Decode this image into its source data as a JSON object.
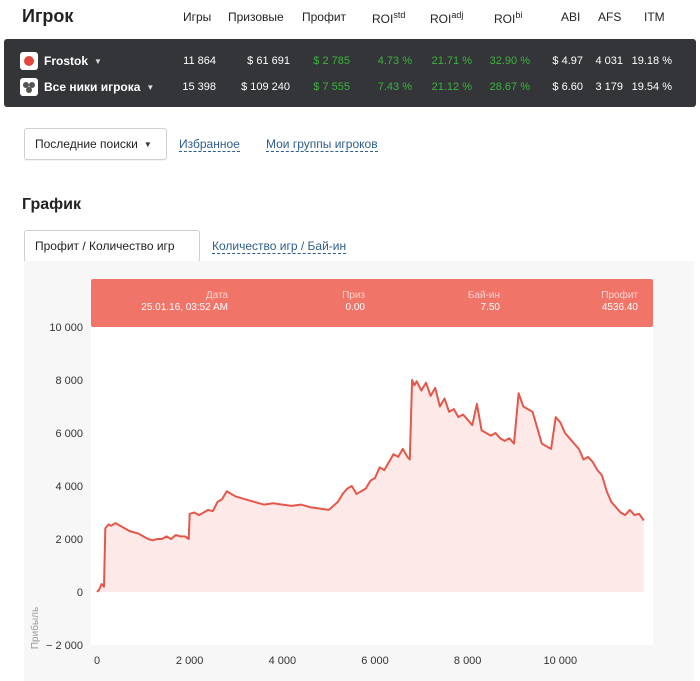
{
  "header": {
    "title": "Игрок",
    "columns": [
      {
        "label": "Игры",
        "sup": ""
      },
      {
        "label": "Призовые",
        "sup": ""
      },
      {
        "label": "Профит",
        "sup": ""
      },
      {
        "label": "ROI",
        "sup": "std"
      },
      {
        "label": "ROI",
        "sup": "adj"
      },
      {
        "label": "ROI",
        "sup": "bi"
      },
      {
        "label": "ABI",
        "sup": ""
      },
      {
        "label": "AFS",
        "sup": ""
      },
      {
        "label": "ITM",
        "sup": ""
      }
    ]
  },
  "players": [
    {
      "name": "Frostok",
      "icon": "pokerstars-icon",
      "games": "11 864",
      "prize": "$ 61 691",
      "profit": "$ 2 785",
      "roi_std": "4.73 %",
      "roi_adj": "21.71 %",
      "roi_bi": "32.90 %",
      "abi": "$ 4.97",
      "afs": "4 031",
      "itm": "19.18 %"
    },
    {
      "name": "Все ники игрока",
      "icon": "group-icon",
      "games": "15 398",
      "prize": "$ 109 240",
      "profit": "$ 7 555",
      "roi_std": "7.43 %",
      "roi_adj": "21.12 %",
      "roi_bi": "28.67 %",
      "abi": "$ 6.60",
      "afs": "3 179",
      "itm": "19.54 %"
    }
  ],
  "search": {
    "recent_label": "Последние поиски",
    "favorites_label": "Избранное",
    "groups_label": "Мои группы игроков"
  },
  "graph": {
    "title": "График",
    "tab_active": "Профит / Количество игр",
    "tab_other": "Количество игр / Бай-ин"
  },
  "tooltip": {
    "date_label": "Дата",
    "date_value": "25.01.16, 03:52 AM",
    "prize_label": "Приз",
    "prize_value": "0.00",
    "buyin_label": "Бай-ин",
    "buyin_value": "7.50",
    "profit_label": "Профит",
    "profit_value": "4536.40"
  },
  "colors": {
    "line": "#e5574a",
    "fill": "#fde9e7",
    "tooltip_bg": "#f17469",
    "positive": "#3fb23f",
    "table_bg": "#333538"
  },
  "chart_data": {
    "type": "area",
    "ylabel": "Прибыль",
    "xlabel": "",
    "xlim": [
      0,
      12000
    ],
    "ylim": [
      -2000,
      10000
    ],
    "x_ticks": [
      0,
      2000,
      4000,
      6000,
      8000,
      10000
    ],
    "x_tick_labels": [
      "0",
      "2 000",
      "4 000",
      "6 000",
      "8 000",
      "10 000"
    ],
    "y_ticks": [
      -2000,
      0,
      2000,
      4000,
      6000,
      8000,
      10000
    ],
    "y_tick_labels": [
      "− 2 000",
      "0",
      "2 000",
      "4 000",
      "6 000",
      "8 000",
      "10 000"
    ],
    "series": [
      {
        "x": [
          0,
          50,
          100,
          150,
          180,
          250,
          300,
          400,
          500,
          700,
          900,
          1100,
          1200,
          1300,
          1400,
          1500,
          1600,
          1700,
          1800,
          1900,
          1980,
          2000,
          2100,
          2200,
          2300,
          2400,
          2500,
          2600,
          2700,
          2800,
          2900,
          3000,
          3200,
          3400,
          3600,
          3800,
          4000,
          4200,
          4400,
          4600,
          4800,
          5000,
          5200,
          5300,
          5400,
          5500,
          5600,
          5700,
          5800,
          5900,
          6000,
          6100,
          6200,
          6300,
          6400,
          6500,
          6600,
          6700,
          6750,
          6800,
          6850,
          6900,
          7000,
          7100,
          7200,
          7300,
          7400,
          7500,
          7600,
          7700,
          7800,
          7900,
          8000,
          8100,
          8200,
          8300,
          8400,
          8500,
          8600,
          8700,
          8800,
          8900,
          9000,
          9100,
          9200,
          9300,
          9400,
          9500,
          9600,
          9700,
          9800,
          9900,
          10000,
          10100,
          10200,
          10300,
          10400,
          10500,
          10600,
          10700,
          10800,
          10900,
          11000,
          11100,
          11200,
          11300,
          11400,
          11500,
          11600,
          11700,
          11800
        ],
        "y": [
          0,
          100,
          300,
          200,
          2400,
          2550,
          2500,
          2600,
          2500,
          2300,
          2200,
          2000,
          1950,
          2000,
          2000,
          2100,
          2000,
          2150,
          2100,
          2100,
          2000,
          2950,
          3000,
          2900,
          3000,
          3100,
          3050,
          3400,
          3500,
          3800,
          3700,
          3600,
          3500,
          3400,
          3300,
          3350,
          3300,
          3250,
          3300,
          3200,
          3150,
          3100,
          3400,
          3700,
          3900,
          4000,
          3700,
          3800,
          3900,
          4200,
          4300,
          4700,
          4600,
          4900,
          5200,
          5100,
          5400,
          5100,
          5000,
          8000,
          7800,
          7950,
          7600,
          7900,
          7400,
          7700,
          7000,
          7300,
          6800,
          6900,
          6600,
          6700,
          6500,
          6300,
          7100,
          6100,
          6000,
          5900,
          6000,
          5800,
          5700,
          5800,
          5600,
          7500,
          7000,
          6900,
          6800,
          6200,
          5600,
          5500,
          5400,
          6600,
          6400,
          6000,
          5800,
          5600,
          5400,
          5000,
          5100,
          4900,
          4600,
          4400,
          3800,
          3400,
          3200,
          3000,
          2900,
          3100,
          2900,
          2950,
          2700
        ]
      }
    ]
  }
}
